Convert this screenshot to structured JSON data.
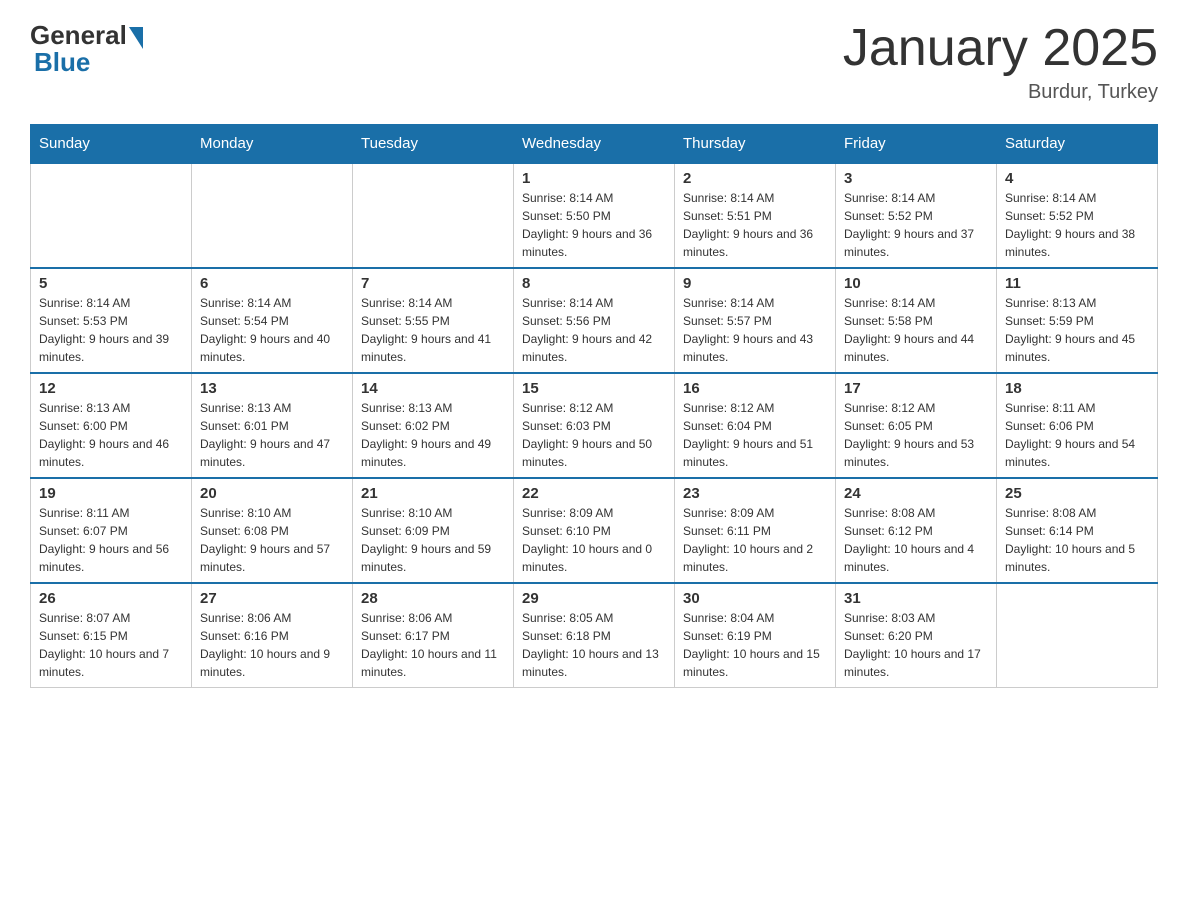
{
  "logo": {
    "general": "General",
    "blue": "Blue"
  },
  "header": {
    "title": "January 2025",
    "location": "Burdur, Turkey"
  },
  "days_of_week": [
    "Sunday",
    "Monday",
    "Tuesday",
    "Wednesday",
    "Thursday",
    "Friday",
    "Saturday"
  ],
  "weeks": [
    [
      {
        "day": "",
        "info": ""
      },
      {
        "day": "",
        "info": ""
      },
      {
        "day": "",
        "info": ""
      },
      {
        "day": "1",
        "info": "Sunrise: 8:14 AM\nSunset: 5:50 PM\nDaylight: 9 hours and 36 minutes."
      },
      {
        "day": "2",
        "info": "Sunrise: 8:14 AM\nSunset: 5:51 PM\nDaylight: 9 hours and 36 minutes."
      },
      {
        "day": "3",
        "info": "Sunrise: 8:14 AM\nSunset: 5:52 PM\nDaylight: 9 hours and 37 minutes."
      },
      {
        "day": "4",
        "info": "Sunrise: 8:14 AM\nSunset: 5:52 PM\nDaylight: 9 hours and 38 minutes."
      }
    ],
    [
      {
        "day": "5",
        "info": "Sunrise: 8:14 AM\nSunset: 5:53 PM\nDaylight: 9 hours and 39 minutes."
      },
      {
        "day": "6",
        "info": "Sunrise: 8:14 AM\nSunset: 5:54 PM\nDaylight: 9 hours and 40 minutes."
      },
      {
        "day": "7",
        "info": "Sunrise: 8:14 AM\nSunset: 5:55 PM\nDaylight: 9 hours and 41 minutes."
      },
      {
        "day": "8",
        "info": "Sunrise: 8:14 AM\nSunset: 5:56 PM\nDaylight: 9 hours and 42 minutes."
      },
      {
        "day": "9",
        "info": "Sunrise: 8:14 AM\nSunset: 5:57 PM\nDaylight: 9 hours and 43 minutes."
      },
      {
        "day": "10",
        "info": "Sunrise: 8:14 AM\nSunset: 5:58 PM\nDaylight: 9 hours and 44 minutes."
      },
      {
        "day": "11",
        "info": "Sunrise: 8:13 AM\nSunset: 5:59 PM\nDaylight: 9 hours and 45 minutes."
      }
    ],
    [
      {
        "day": "12",
        "info": "Sunrise: 8:13 AM\nSunset: 6:00 PM\nDaylight: 9 hours and 46 minutes."
      },
      {
        "day": "13",
        "info": "Sunrise: 8:13 AM\nSunset: 6:01 PM\nDaylight: 9 hours and 47 minutes."
      },
      {
        "day": "14",
        "info": "Sunrise: 8:13 AM\nSunset: 6:02 PM\nDaylight: 9 hours and 49 minutes."
      },
      {
        "day": "15",
        "info": "Sunrise: 8:12 AM\nSunset: 6:03 PM\nDaylight: 9 hours and 50 minutes."
      },
      {
        "day": "16",
        "info": "Sunrise: 8:12 AM\nSunset: 6:04 PM\nDaylight: 9 hours and 51 minutes."
      },
      {
        "day": "17",
        "info": "Sunrise: 8:12 AM\nSunset: 6:05 PM\nDaylight: 9 hours and 53 minutes."
      },
      {
        "day": "18",
        "info": "Sunrise: 8:11 AM\nSunset: 6:06 PM\nDaylight: 9 hours and 54 minutes."
      }
    ],
    [
      {
        "day": "19",
        "info": "Sunrise: 8:11 AM\nSunset: 6:07 PM\nDaylight: 9 hours and 56 minutes."
      },
      {
        "day": "20",
        "info": "Sunrise: 8:10 AM\nSunset: 6:08 PM\nDaylight: 9 hours and 57 minutes."
      },
      {
        "day": "21",
        "info": "Sunrise: 8:10 AM\nSunset: 6:09 PM\nDaylight: 9 hours and 59 minutes."
      },
      {
        "day": "22",
        "info": "Sunrise: 8:09 AM\nSunset: 6:10 PM\nDaylight: 10 hours and 0 minutes."
      },
      {
        "day": "23",
        "info": "Sunrise: 8:09 AM\nSunset: 6:11 PM\nDaylight: 10 hours and 2 minutes."
      },
      {
        "day": "24",
        "info": "Sunrise: 8:08 AM\nSunset: 6:12 PM\nDaylight: 10 hours and 4 minutes."
      },
      {
        "day": "25",
        "info": "Sunrise: 8:08 AM\nSunset: 6:14 PM\nDaylight: 10 hours and 5 minutes."
      }
    ],
    [
      {
        "day": "26",
        "info": "Sunrise: 8:07 AM\nSunset: 6:15 PM\nDaylight: 10 hours and 7 minutes."
      },
      {
        "day": "27",
        "info": "Sunrise: 8:06 AM\nSunset: 6:16 PM\nDaylight: 10 hours and 9 minutes."
      },
      {
        "day": "28",
        "info": "Sunrise: 8:06 AM\nSunset: 6:17 PM\nDaylight: 10 hours and 11 minutes."
      },
      {
        "day": "29",
        "info": "Sunrise: 8:05 AM\nSunset: 6:18 PM\nDaylight: 10 hours and 13 minutes."
      },
      {
        "day": "30",
        "info": "Sunrise: 8:04 AM\nSunset: 6:19 PM\nDaylight: 10 hours and 15 minutes."
      },
      {
        "day": "31",
        "info": "Sunrise: 8:03 AM\nSunset: 6:20 PM\nDaylight: 10 hours and 17 minutes."
      },
      {
        "day": "",
        "info": ""
      }
    ]
  ]
}
